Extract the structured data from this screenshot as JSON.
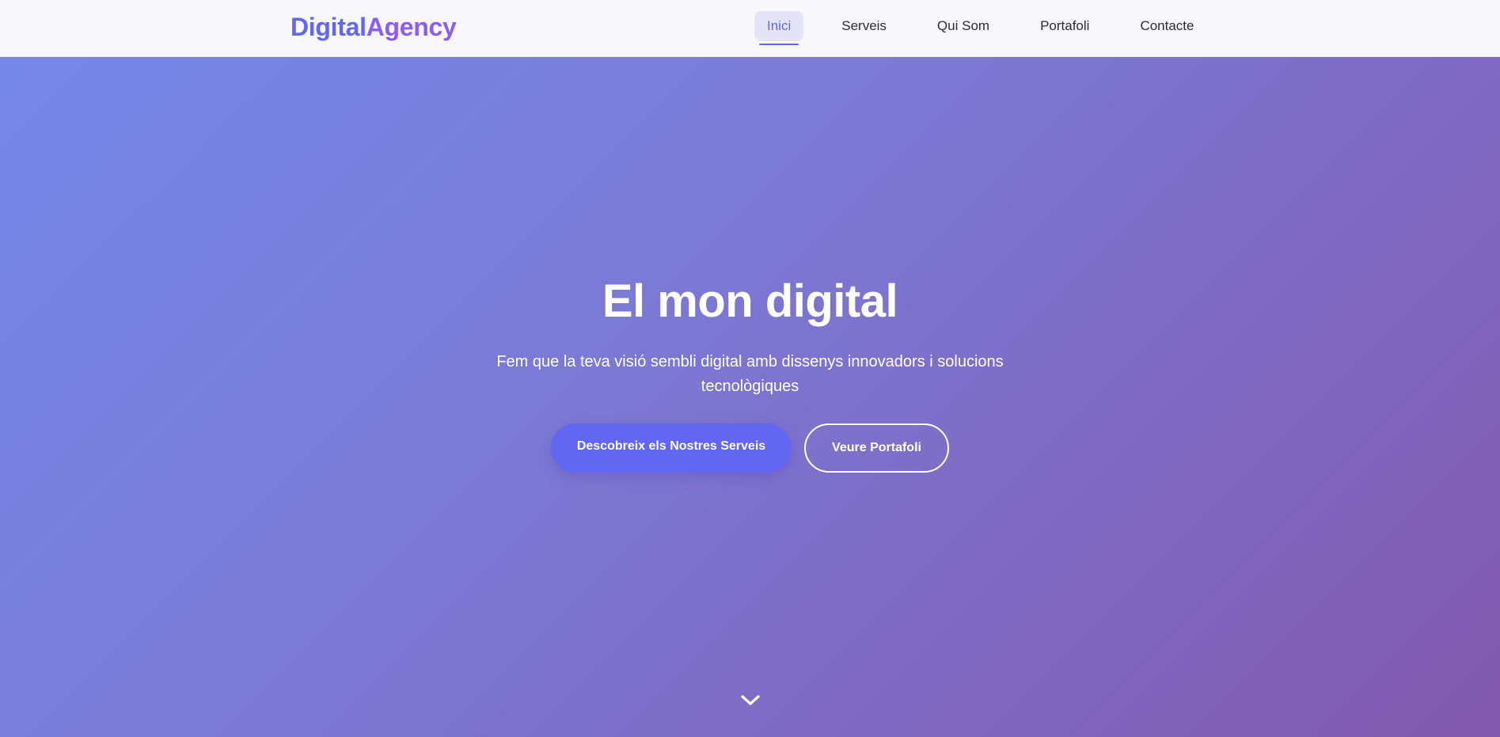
{
  "brand": {
    "part1": "Digital",
    "part2": "Agency",
    "color1": "#6366f1",
    "color2": "#8b5cf6"
  },
  "nav": {
    "items": [
      {
        "label": "Inici",
        "active": true
      },
      {
        "label": "Serveis",
        "active": false
      },
      {
        "label": "Qui Som",
        "active": false
      },
      {
        "label": "Portafoli",
        "active": false
      },
      {
        "label": "Contacte",
        "active": false
      }
    ]
  },
  "hero": {
    "title": "El mon digital",
    "subtitle": "Fem que la teva visió sembli digital amb dissenys innovadors i solucions tecnològiques",
    "primary_button": "Descobreix els Nostres Serveis",
    "secondary_button": "Veure Portafoli",
    "scroll_icon": "chevron-down-icon"
  },
  "colors": {
    "accent": "#6366f1",
    "gradient_start": "#7588e9",
    "gradient_end": "#8159ad",
    "text_on_hero": "#ffffff"
  }
}
